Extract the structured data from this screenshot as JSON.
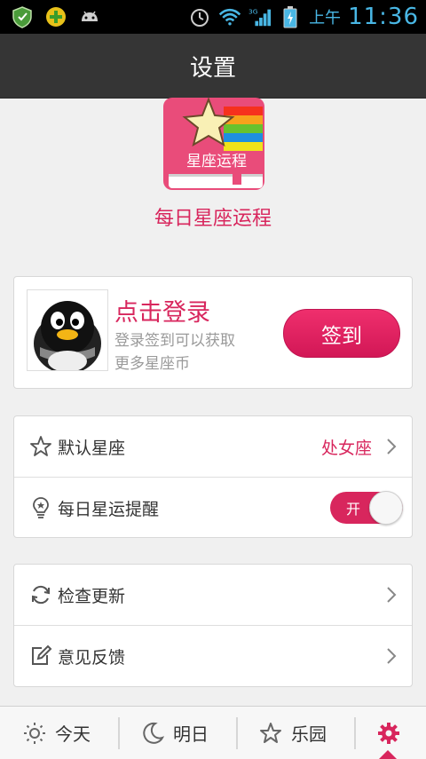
{
  "status_bar": {
    "ampm": "上午",
    "time": "11:36",
    "network": "3G",
    "icons": [
      "shield-icon",
      "plus-app-icon",
      "android-icon",
      "alarm-icon",
      "wifi-icon",
      "signal-icon",
      "battery-icon"
    ]
  },
  "title_bar": {
    "title": "设置"
  },
  "app": {
    "name": "每日星座运程",
    "logo_text": "星座运程"
  },
  "login": {
    "title": "点击登录",
    "desc_line1": "登录签到可以获取",
    "desc_line2": "更多星座币",
    "button": "签到"
  },
  "preferences": {
    "default_sign_label": "默认星座",
    "default_sign_value": "处女座",
    "daily_reminder_label": "每日星运提醒",
    "daily_reminder_toggle": "开"
  },
  "misc": {
    "check_update": "检查更新",
    "feedback": "意见反馈"
  },
  "bottom_nav": {
    "today": "今天",
    "tomorrow": "明日",
    "park": "乐园",
    "active": "settings"
  },
  "colors": {
    "accent": "#d8265d",
    "title_bar": "#353535"
  }
}
